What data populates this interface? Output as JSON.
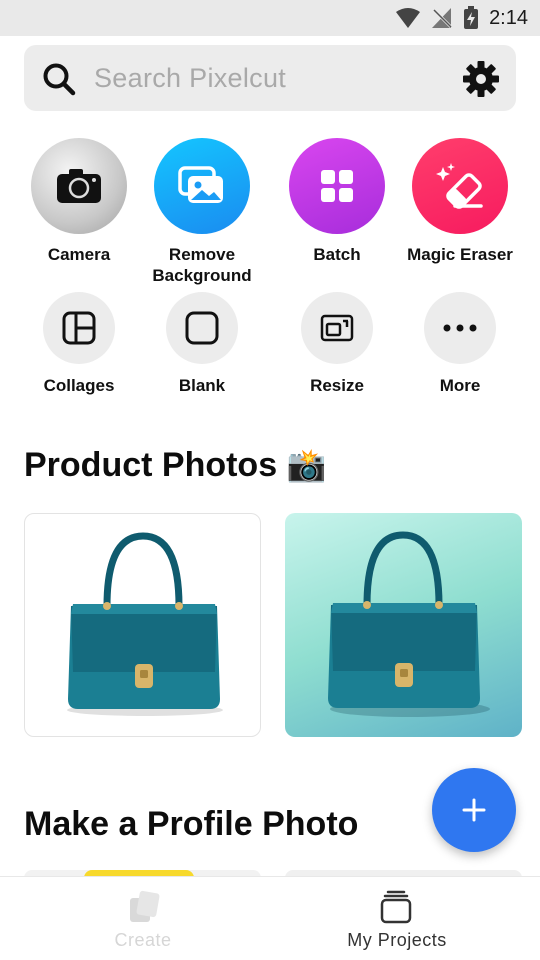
{
  "status_bar": {
    "time": "2:14",
    "icons": [
      "wifi-icon",
      "no-signal-icon",
      "battery-charging-icon"
    ]
  },
  "search": {
    "placeholder": "Search Pixelcut",
    "value": "",
    "search_icon": "search-icon",
    "settings_icon": "gear-icon"
  },
  "tools_primary": [
    {
      "label": "Camera",
      "icon": "camera-icon"
    },
    {
      "label": "Remove\nBackground",
      "icon": "image-icon"
    },
    {
      "label": "Batch",
      "icon": "grid-icon"
    },
    {
      "label": "Magic Eraser",
      "icon": "eraser-icon"
    }
  ],
  "tools_secondary": [
    {
      "label": "Collages",
      "icon": "collage-icon"
    },
    {
      "label": "Blank",
      "icon": "blank-square-icon"
    },
    {
      "label": "Resize",
      "icon": "resize-icon"
    },
    {
      "label": "More",
      "icon": "more-dots-icon"
    }
  ],
  "sections": {
    "product_photos": {
      "title": "Product Photos",
      "emoji": "📸"
    },
    "profile_photo": {
      "title": "Make a Profile Photo"
    }
  },
  "bottom_nav": {
    "create_label": "Create",
    "projects_label": "My Projects"
  },
  "colors": {
    "accent": "#2f77f0",
    "remove_bg": "#1a8bf0",
    "batch": "#b737e6",
    "eraser": "#f71b5f"
  }
}
